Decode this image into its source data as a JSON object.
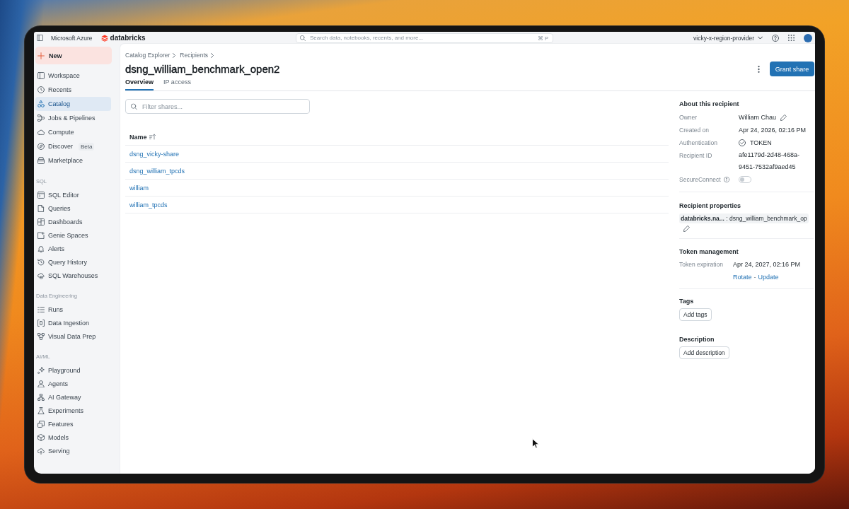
{
  "top_bar": {
    "cloud": "Microsoft Azure",
    "logo": "databricks",
    "search": {
      "placeholder": "Search data, notebooks, recents, and more...",
      "shortcut": "⌘ P"
    },
    "workspace": "vicky-x-region-provider"
  },
  "sidebar": {
    "new_button": "New",
    "sections": [
      {
        "items": [
          {
            "label": "Workspace",
            "selected": false
          },
          {
            "label": "Recents",
            "selected": false
          },
          {
            "label": "Catalog",
            "selected": true
          },
          {
            "label": "Jobs & Pipelines",
            "selected": false
          },
          {
            "label": "Compute",
            "selected": false
          },
          {
            "label": "Discover",
            "badge": "Beta",
            "selected": false
          },
          {
            "label": "Marketplace",
            "selected": false
          }
        ]
      },
      {
        "title": "SQL",
        "items": [
          {
            "label": "SQL Editor",
            "selected": false
          },
          {
            "label": "Queries",
            "selected": false
          },
          {
            "label": "Dashboards",
            "selected": false
          },
          {
            "label": "Genie Spaces",
            "selected": false
          },
          {
            "label": "Alerts",
            "selected": false
          },
          {
            "label": "Query History",
            "selected": false
          },
          {
            "label": "SQL Warehouses",
            "selected": false
          }
        ]
      },
      {
        "title": "Data Engineering",
        "items": [
          {
            "label": "Runs",
            "selected": false
          },
          {
            "label": "Data Ingestion",
            "selected": false
          },
          {
            "label": "Visual Data Prep",
            "selected": false
          }
        ]
      },
      {
        "title": "AI/ML",
        "items": [
          {
            "label": "Playground",
            "selected": false
          },
          {
            "label": "Agents",
            "selected": false
          },
          {
            "label": "AI Gateway",
            "selected": false
          },
          {
            "label": "Experiments",
            "selected": false
          },
          {
            "label": "Features",
            "selected": false
          },
          {
            "label": "Models",
            "selected": false
          },
          {
            "label": "Serving",
            "selected": false
          }
        ]
      }
    ]
  },
  "breadcrumb": [
    "Catalog Explorer",
    "Recipients"
  ],
  "title": "dsng_william_benchmark_open2",
  "actions": {
    "primary": "Grant share"
  },
  "tabs": [
    {
      "label": "Overview",
      "selected": true
    },
    {
      "label": "IP access",
      "selected": false
    }
  ],
  "filter": {
    "placeholder": "Filter shares..."
  },
  "table": {
    "columns": [
      "Name"
    ],
    "rows": [
      {
        "name": "dsng_vicky-share"
      },
      {
        "name": "dsng_william_tpcds"
      },
      {
        "name": "william"
      },
      {
        "name": "william_tpcds"
      }
    ]
  },
  "details": {
    "about": {
      "title": "About this recipient",
      "fields": [
        {
          "label": "Owner",
          "kind": "editable",
          "value": "William Chau",
          "info": false
        },
        {
          "label": "Created on",
          "kind": "text",
          "value": "Apr 24, 2026, 02:16 PM",
          "info": false
        },
        {
          "label": "Authentication",
          "kind": "verified",
          "value": "TOKEN",
          "info": false
        },
        {
          "label": "Recipient ID",
          "kind": "text",
          "value": "afe1179d-2d48-468a-9451-7532af9aed45",
          "info": false
        },
        {
          "label": "SecureConnect",
          "kind": "toggle",
          "on": false,
          "info": true
        }
      ]
    },
    "properties": {
      "title": "Recipient properties",
      "items": [
        "**databricks.na...** : dsng_william_benchmark_op"
      ]
    },
    "token": {
      "title": "Token management",
      "fields": [
        {
          "label": "Token expiration",
          "kind": "text",
          "value": "Apr 24, 2027, 02:16 PM",
          "info": false
        }
      ],
      "links": [
        "Rotate",
        "Update"
      ],
      "link_separator": "-"
    },
    "tags": {
      "title": "Tags",
      "button": "Add tags"
    },
    "description": {
      "title": "Description",
      "button": "Add description"
    }
  }
}
